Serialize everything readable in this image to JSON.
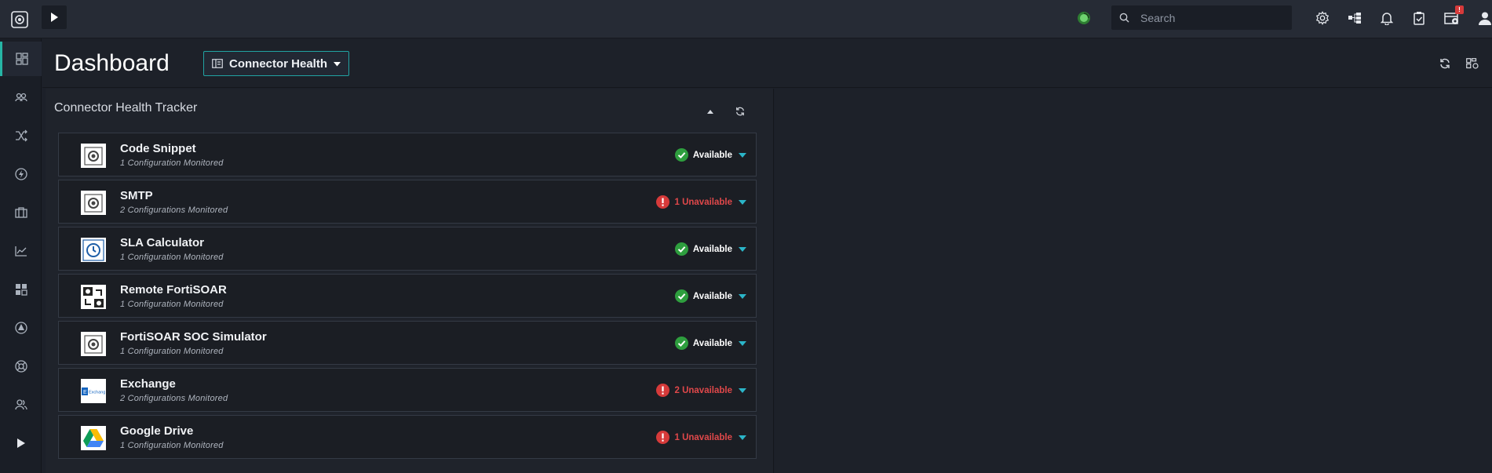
{
  "app": {
    "search_placeholder": "Search",
    "notification_badge": "!"
  },
  "header": {
    "title": "Dashboard",
    "selector_label": "Connector Health"
  },
  "widget": {
    "title": "Connector Health Tracker",
    "connectors": [
      {
        "name": "Code Snippet",
        "sub": "1 Configuration Monitored",
        "status": "Available",
        "state": "ok",
        "icon": "code-snippet-icon"
      },
      {
        "name": "SMTP",
        "sub": "2 Configurations Monitored",
        "status": "1 Unavailable",
        "state": "bad",
        "icon": "smtp-icon"
      },
      {
        "name": "SLA Calculator",
        "sub": "1 Configuration Monitored",
        "status": "Available",
        "state": "ok",
        "icon": "clock-icon"
      },
      {
        "name": "Remote FortiSOAR",
        "sub": "1 Configuration Monitored",
        "status": "Available",
        "state": "ok",
        "icon": "remote-sync-icon"
      },
      {
        "name": "FortiSOAR SOC Simulator",
        "sub": "1 Configuration Monitored",
        "status": "Available",
        "state": "ok",
        "icon": "soc-simulator-icon"
      },
      {
        "name": "Exchange",
        "sub": "2 Configurations Monitored",
        "status": "2 Unavailable",
        "state": "bad",
        "icon": "exchange-logo"
      },
      {
        "name": "Google Drive",
        "sub": "1 Configuration Monitored",
        "status": "1 Unavailable",
        "state": "bad",
        "icon": "google-drive-logo"
      }
    ]
  },
  "colors": {
    "accent": "#26b5a5",
    "available": "#2e9e3e",
    "unavailable": "#e0484a"
  }
}
